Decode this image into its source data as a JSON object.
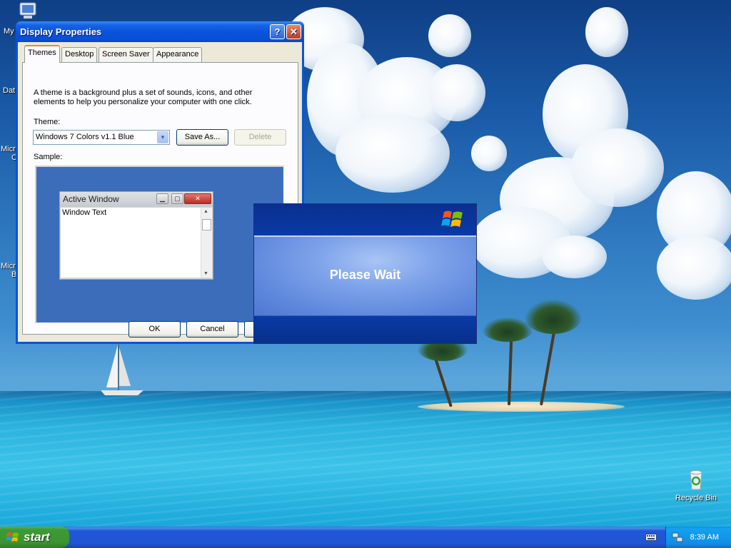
{
  "desktop": {
    "icons": [
      {
        "label": "My"
      },
      {
        "label": "Dat"
      },
      {
        "label": "Micro"
      },
      {
        "label": "C"
      },
      {
        "label": "Micro"
      },
      {
        "label": "B"
      }
    ],
    "recycle_bin": {
      "label": "Recycle Bin"
    }
  },
  "dialog": {
    "title": "Display Properties",
    "help_glyph": "?",
    "close_glyph": "✕",
    "tabs": [
      {
        "label": "Themes",
        "active": true
      },
      {
        "label": "Desktop",
        "active": false
      },
      {
        "label": "Screen Saver",
        "active": false
      },
      {
        "label": "Appearance",
        "active": false
      }
    ],
    "description": "A theme is a background plus a set of sounds, icons, and other elements to help you personalize your computer with one click.",
    "theme_label": "Theme:",
    "theme_value": "Windows 7 Colors v1.1 Blue",
    "save_as_label": "Save As...",
    "delete_label": "Delete",
    "sample_label": "Sample:",
    "sample": {
      "window_title": "Active Window",
      "window_text": "Window Text"
    },
    "ok_label": "OK",
    "cancel_label": "Cancel"
  },
  "wait_window": {
    "message": "Please Wait"
  },
  "taskbar": {
    "start_label": "start",
    "clock": "8:39 AM"
  },
  "colors": {
    "xp_blue": "#0a52dd",
    "start_green": "#3c9a34",
    "tray_blue": "#0f8ee6"
  }
}
